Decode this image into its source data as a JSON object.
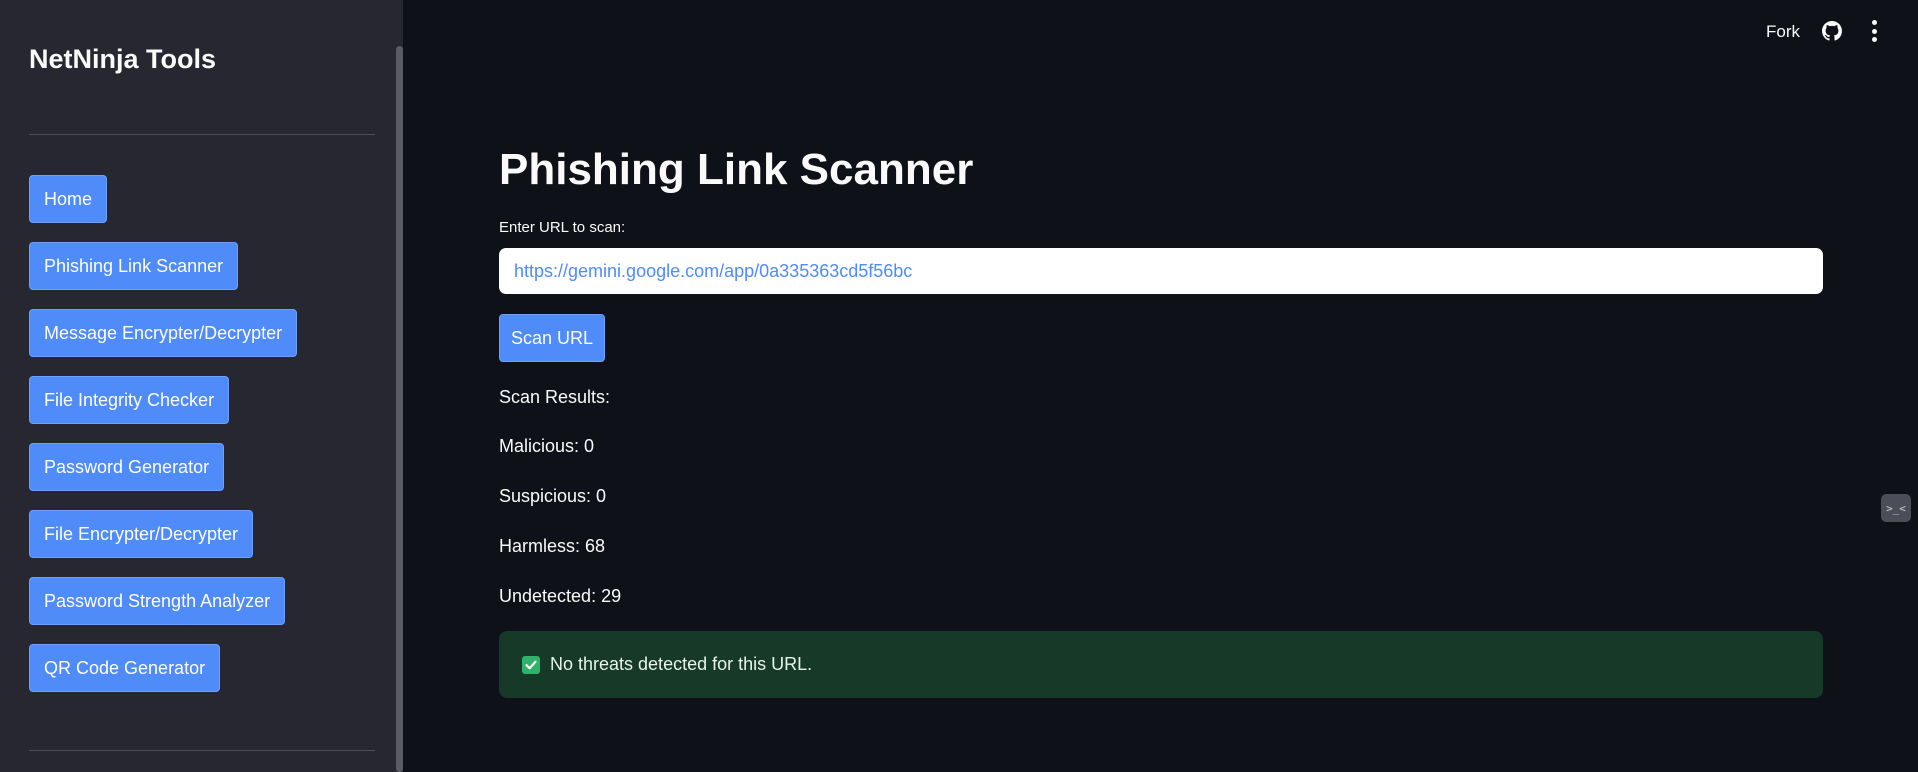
{
  "sidebar": {
    "title": "NetNinja Tools",
    "items": [
      {
        "label": "Home"
      },
      {
        "label": "Phishing Link Scanner"
      },
      {
        "label": "Message Encrypter/Decrypter"
      },
      {
        "label": "File Integrity Checker"
      },
      {
        "label": "Password Generator"
      },
      {
        "label": "File Encrypter/Decrypter"
      },
      {
        "label": "Password Strength Analyzer"
      },
      {
        "label": "QR Code Generator"
      }
    ]
  },
  "header": {
    "fork_label": "Fork",
    "github_icon": "github-icon",
    "menu_icon": "kebab-menu-icon"
  },
  "main": {
    "title": "Phishing Link Scanner",
    "url_label": "Enter URL to scan:",
    "url_value": "https://gemini.google.com/app/0a335363cd5f56bc",
    "scan_button": "Scan URL",
    "results": {
      "heading": "Scan Results:",
      "malicious": "Malicious: 0",
      "suspicious": "Suspicious: 0",
      "harmless": "Harmless: 68",
      "undetected": "Undetected: 29"
    },
    "success_message": "No threats detected for this URL."
  },
  "widget": {
    "glyph": ">_<"
  },
  "colors": {
    "background": "#0e1117",
    "sidebar": "#262730",
    "accent": "#4f8bf9",
    "success_bg": "#173928",
    "success_check": "#2fb36b"
  }
}
